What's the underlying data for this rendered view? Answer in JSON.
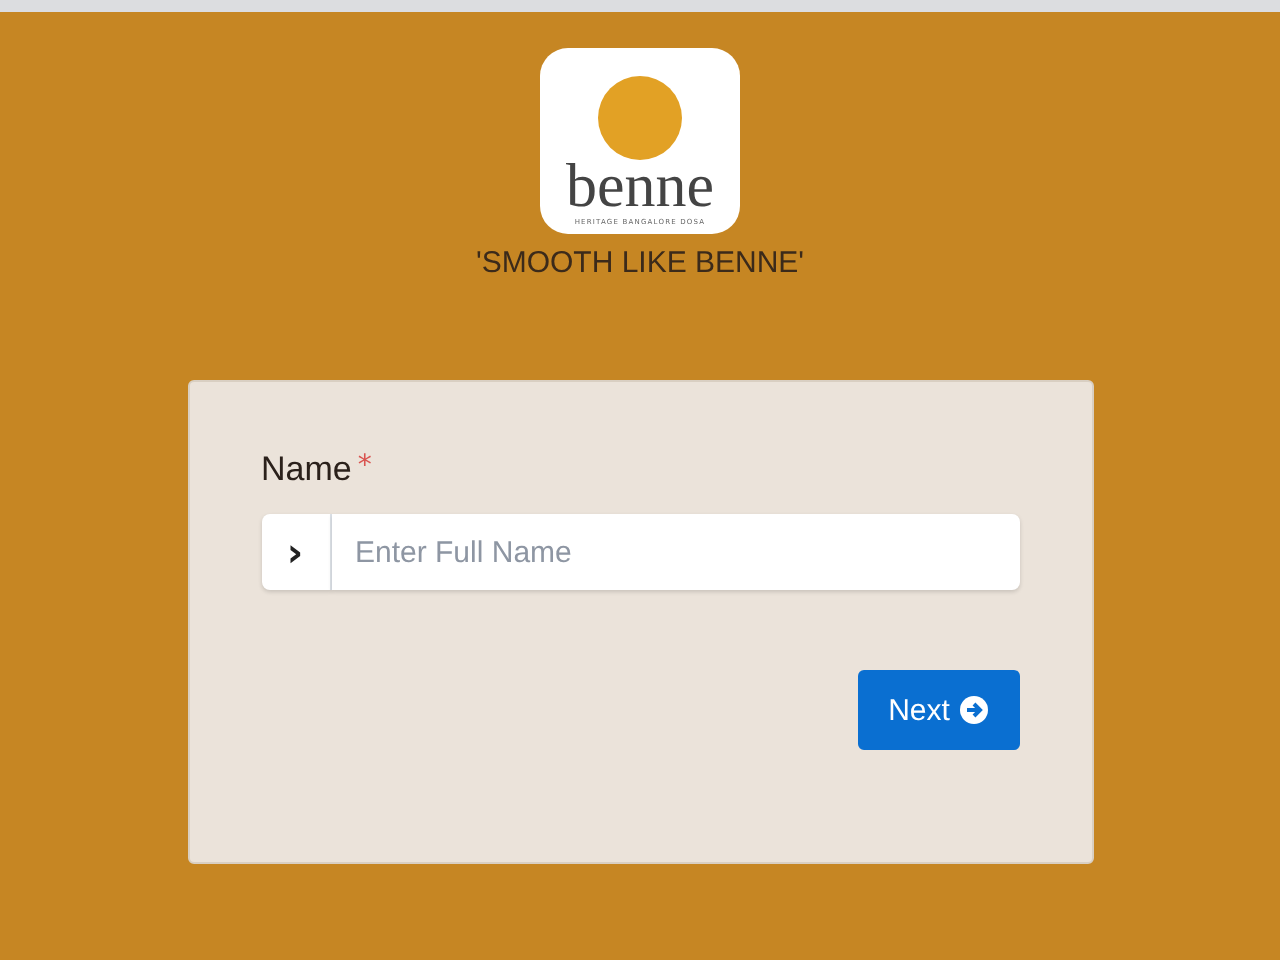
{
  "logo": {
    "wordmark": "benne",
    "subtitle": "HERITAGE BANGALORE DOSA"
  },
  "tagline": "'SMOOTH LIKE BENNE'",
  "form": {
    "field": {
      "label": "Name",
      "required_mark": "*",
      "prefix": "›",
      "placeholder": "Enter Full Name"
    },
    "submit": "Next"
  }
}
